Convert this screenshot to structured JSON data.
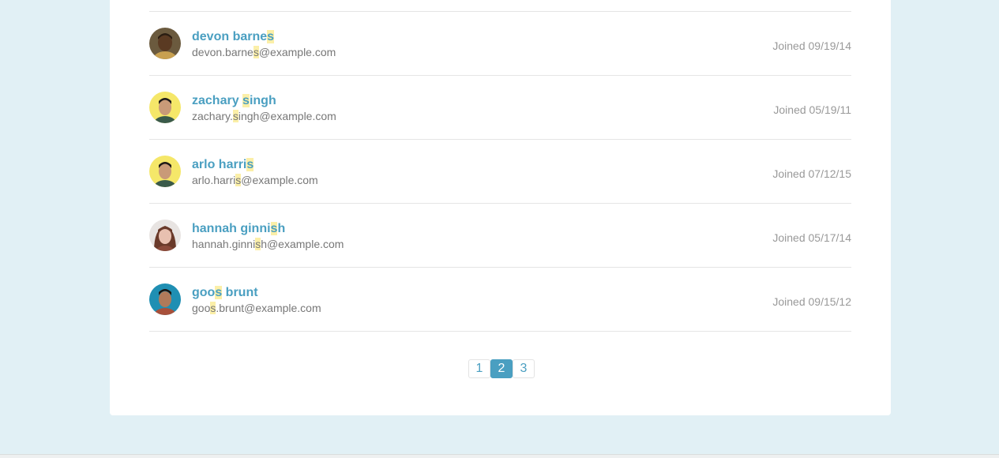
{
  "users": [
    {
      "name_parts": [
        "devon barne",
        "s",
        ""
      ],
      "email_parts": [
        "devon.barne",
        "s",
        "@example.com"
      ],
      "joined": "Joined 09/19/14",
      "avatar": {
        "bg": "#6b5a3e",
        "skin": "#5a3a22",
        "hair": "#2a1d12",
        "shirt": "#c8a050"
      }
    },
    {
      "name_parts": [
        "zachary ",
        "s",
        "ingh"
      ],
      "email_parts": [
        "zachary.",
        "s",
        "ingh@example.com"
      ],
      "joined": "Joined 05/19/11",
      "avatar": {
        "bg": "#f5e769",
        "skin": "#c99a78",
        "hair": "#1e1a18",
        "shirt": "#3a5a4a"
      }
    },
    {
      "name_parts": [
        "arlo harri",
        "s",
        ""
      ],
      "email_parts": [
        "arlo.harri",
        "s",
        "@example.com"
      ],
      "joined": "Joined 07/12/15",
      "avatar": {
        "bg": "#f5e769",
        "skin": "#c99a78",
        "hair": "#1e1a18",
        "shirt": "#3a5a4a"
      }
    },
    {
      "name_parts": [
        "hannah ginni",
        "s",
        "h"
      ],
      "email_parts": [
        "hannah.ginni",
        "s",
        "h@example.com"
      ],
      "joined": "Joined 05/17/14",
      "avatar": {
        "bg": "#e8e4e2",
        "skin": "#e8c0b0",
        "hair": "#6a3a2a",
        "shirt": "#8a4a3a"
      }
    },
    {
      "name_parts": [
        "goo",
        "s",
        " brunt"
      ],
      "email_parts": [
        "goo",
        "s",
        ".brunt@example.com"
      ],
      "joined": "Joined 09/15/12",
      "avatar": {
        "bg": "#1f8fb3",
        "skin": "#b07a5a",
        "hair": "#1a1410",
        "shirt": "#a8503a"
      }
    }
  ],
  "pagination": {
    "pages": [
      "1",
      "2",
      "3"
    ],
    "active_index": 1
  },
  "colors": {
    "accent": "#4a9fc1",
    "highlight": "#fbefa8",
    "background": "#e1f0f5"
  }
}
